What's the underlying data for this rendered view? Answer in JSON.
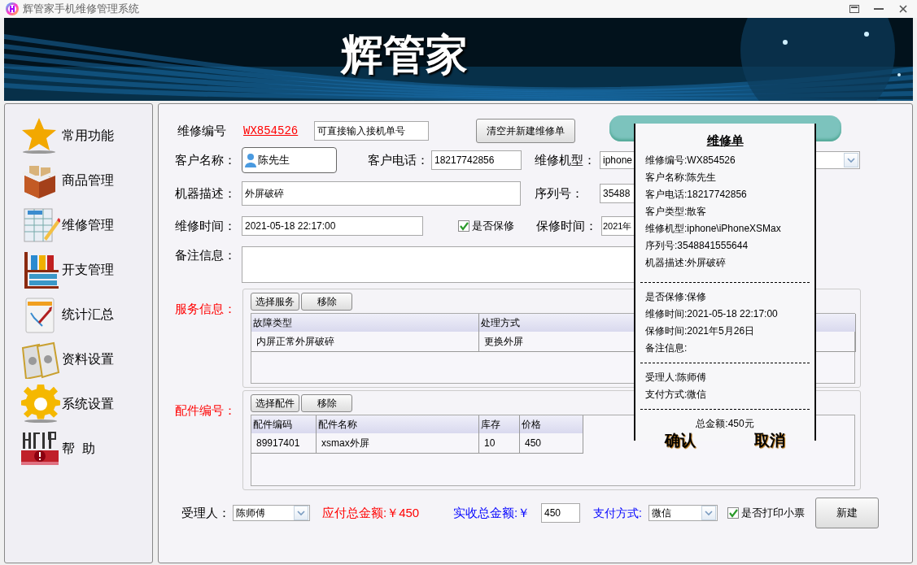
{
  "window": {
    "title": "辉管家手机维修管理系统"
  },
  "banner": {
    "title": "辉管家"
  },
  "sidebar": {
    "items": [
      {
        "label": "常用功能",
        "kind": "star"
      },
      {
        "label": "商品管理",
        "kind": "box"
      },
      {
        "label": "维修管理",
        "kind": "sheet"
      },
      {
        "label": "开支管理",
        "kind": "shelf"
      },
      {
        "label": "统计汇总",
        "kind": "chart"
      },
      {
        "label": "资料设置",
        "kind": "papers"
      },
      {
        "label": "系统设置",
        "kind": "gear"
      },
      {
        "label": "帮  助",
        "kind": "help"
      }
    ]
  },
  "form": {
    "repair_number": {
      "label": "维修编号",
      "value": "WX854526"
    },
    "order_field": {
      "value": "可直接输入接机单号"
    },
    "clear_button": {
      "label": "清空并新建维修单"
    },
    "customer_name": {
      "label": "客户名称：",
      "value": "陈先生"
    },
    "customer_phone": {
      "label": "客户电话：",
      "value": "18217742856"
    },
    "model": {
      "label": "维修机型：",
      "value": "iphone"
    },
    "description": {
      "label": "机器描述：",
      "value": "外屏破碎"
    },
    "serial": {
      "label": "序列号：",
      "value": "35488"
    },
    "repair_time": {
      "label": "维修时间：",
      "value": "2021-05-18 22:17:00"
    },
    "warranty_check": {
      "label": "是否保修",
      "checked": true
    },
    "warranty_time": {
      "label": "保修时间：",
      "value": "2021年"
    },
    "notes": {
      "label": "备注信息："
    }
  },
  "services": {
    "label": "服务信息：",
    "buttons": [
      "选择服务",
      "移除"
    ],
    "columns": [
      "故障类型",
      "处理方式"
    ],
    "rows": [
      [
        "内屏正常外屏破碎",
        "更换外屏"
      ]
    ]
  },
  "parts": {
    "label": "配件编号：",
    "buttons": [
      "选择配件",
      "移除"
    ],
    "columns": [
      "配件编码",
      "配件名称",
      "库存",
      "价格"
    ],
    "rows": [
      [
        "89917401",
        "xsmax外屏",
        "10",
        "450"
      ]
    ]
  },
  "footer": {
    "handler": {
      "label": "受理人：",
      "value": "陈师傅"
    },
    "payable": "应付总金额:￥450",
    "received": {
      "label": "实收总金额:￥",
      "value": "450"
    },
    "payment": {
      "label": "支付方式:",
      "value": "微信"
    },
    "print_check": {
      "label": "是否打印小票",
      "checked": true
    },
    "new_button": "新建"
  },
  "receipt": {
    "title": "维修单",
    "sections": [
      [
        "维修编号:WX854526",
        "客户名称:陈先生",
        "客户电话:18217742856",
        "客户类型:散客",
        "维修机型:iphone\\iPhoneXSMax",
        "序列号:3548841555644",
        "机器描述:外屏破碎"
      ],
      [
        "是否保修:保修",
        "维修时间:2021-05-18 22:17:00",
        "保修时间:2021年5月26日",
        "备注信息:"
      ],
      [
        "受理人:陈师傅",
        "支付方式:微信"
      ]
    ],
    "total": "总金额:450元",
    "buttons": [
      "确认",
      "取消"
    ]
  }
}
